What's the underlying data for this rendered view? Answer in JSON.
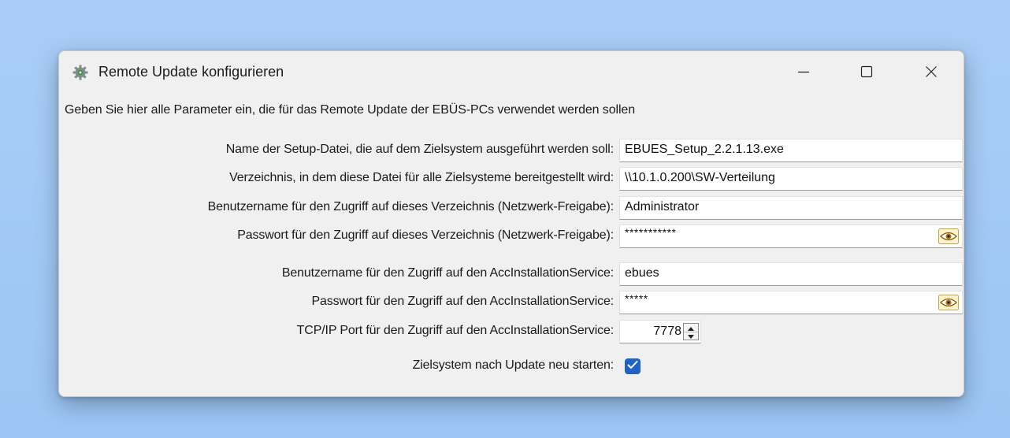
{
  "window": {
    "title": "Remote Update konfigurieren",
    "description": "Geben Sie hier alle Parameter ein, die für das Remote Update der EBÜS-PCs verwendet werden sollen"
  },
  "fields": {
    "setup_file": {
      "label": "Name der Setup-Datei, die auf dem Zielsystem ausgeführt werden soll:",
      "value": "EBUES_Setup_2.2.1.13.exe"
    },
    "share_dir": {
      "label": "Verzeichnis, in dem diese Datei für alle Zielsysteme bereitgestellt wird:",
      "value": "\\\\10.1.0.200\\SW-Verteilung"
    },
    "share_user": {
      "label": "Benutzername für den Zugriff auf dieses Verzeichnis (Netzwerk-Freigabe):",
      "value": "Administrator"
    },
    "share_password": {
      "label": "Passwort für den Zugriff auf dieses Verzeichnis (Netzwerk-Freigabe):",
      "value": "***********"
    },
    "service_user": {
      "label": "Benutzername für den Zugriff auf den AccInstallationService:",
      "value": "ebues"
    },
    "service_password": {
      "label": "Passwort für den Zugriff auf den AccInstallationService:",
      "value": "*****"
    },
    "service_port": {
      "label": "TCP/IP Port für den Zugriff auf den AccInstallationService:",
      "value": "7778"
    },
    "restart": {
      "label": "Zielsystem nach Update neu starten:",
      "checked": true
    }
  },
  "colors": {
    "checkbox_accent": "#1f63c4",
    "eye_icon": "#b07a10"
  },
  "icons": {
    "app": "gear-icon",
    "minimize": "minimize-icon",
    "maximize": "maximize-icon",
    "close": "close-icon",
    "reveal_password": "eye-icon"
  }
}
